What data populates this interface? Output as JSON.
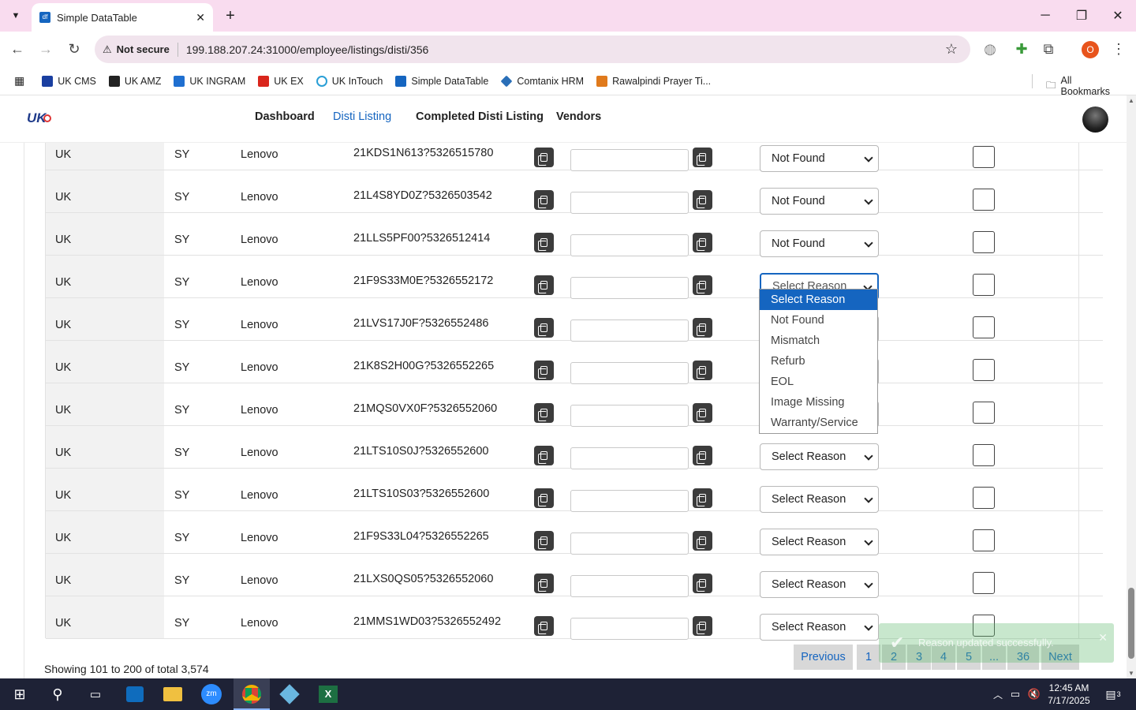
{
  "browser": {
    "tab_title": "Simple DataTable",
    "security_label": "Not secure",
    "url": "199.188.207.24:31000/employee/listings/disti/356",
    "profile_initial": "O",
    "bookmarks": [
      "UK CMS",
      "UK AMZ",
      "UK INGRAM",
      "UK EX",
      "UK InTouch",
      "Simple DataTable",
      "Comtanix HRM",
      "Rawalpindi Prayer Ti..."
    ],
    "all_bookmarks": "All Bookmarks"
  },
  "nav": {
    "logo": "UK",
    "items": [
      "Dashboard",
      "Disti Listing",
      "Completed Disti Listing",
      "Vendors"
    ],
    "active": "Disti Listing"
  },
  "table": {
    "rows": [
      {
        "region": "UK",
        "code": "SY",
        "brand": "Lenovo",
        "sku": "21KDS1N613?5326515780",
        "reason": "Not Found"
      },
      {
        "region": "UK",
        "code": "SY",
        "brand": "Lenovo",
        "sku": "21L4S8YD0Z?5326503542",
        "reason": "Not Found"
      },
      {
        "region": "UK",
        "code": "SY",
        "brand": "Lenovo",
        "sku": "21LLS5PF00?5326512414",
        "reason": "Not Found"
      },
      {
        "region": "UK",
        "code": "SY",
        "brand": "Lenovo",
        "sku": "21F9S33M0E?5326552172",
        "reason": "Select Reason"
      },
      {
        "region": "UK",
        "code": "SY",
        "brand": "Lenovo",
        "sku": "21LVS17J0F?5326552486",
        "reason": "Select Reason"
      },
      {
        "region": "UK",
        "code": "SY",
        "brand": "Lenovo",
        "sku": "21K8S2H00G?5326552265",
        "reason": "Select Reason"
      },
      {
        "region": "UK",
        "code": "SY",
        "brand": "Lenovo",
        "sku": "21MQS0VX0F?5326552060",
        "reason": "Select Reason"
      },
      {
        "region": "UK",
        "code": "SY",
        "brand": "Lenovo",
        "sku": "21LTS10S0J?5326552600",
        "reason": "Select Reason"
      },
      {
        "region": "UK",
        "code": "SY",
        "brand": "Lenovo",
        "sku": "21LTS10S03?5326552600",
        "reason": "Select Reason"
      },
      {
        "region": "UK",
        "code": "SY",
        "brand": "Lenovo",
        "sku": "21F9S33L04?5326552265",
        "reason": "Select Reason"
      },
      {
        "region": "UK",
        "code": "SY",
        "brand": "Lenovo",
        "sku": "21LXS0QS05?5326552060",
        "reason": "Select Reason"
      },
      {
        "region": "UK",
        "code": "SY",
        "brand": "Lenovo",
        "sku": "21MMS1WD03?5326552492",
        "reason": "Select Reason"
      }
    ]
  },
  "dropdown": {
    "options": [
      "Select Reason",
      "Not Found",
      "Mismatch",
      "Refurb",
      "EOL",
      "Image Missing",
      "Warranty/Service"
    ],
    "highlighted": "Select Reason"
  },
  "toast": {
    "message": "Reason updated successfully."
  },
  "footer": {
    "showing": "Showing 101 to 200 of total 3,574",
    "pagination": [
      "Previous",
      "1",
      "2",
      "3",
      "4",
      "5",
      "...",
      "36",
      "Next"
    ]
  },
  "taskbar": {
    "time": "12:45 AM",
    "date": "7/17/2025",
    "notifications": "3"
  },
  "colors": {
    "accent": "#1565c0",
    "tab_strip": "#f9dcef",
    "taskbar": "#1e2236"
  }
}
